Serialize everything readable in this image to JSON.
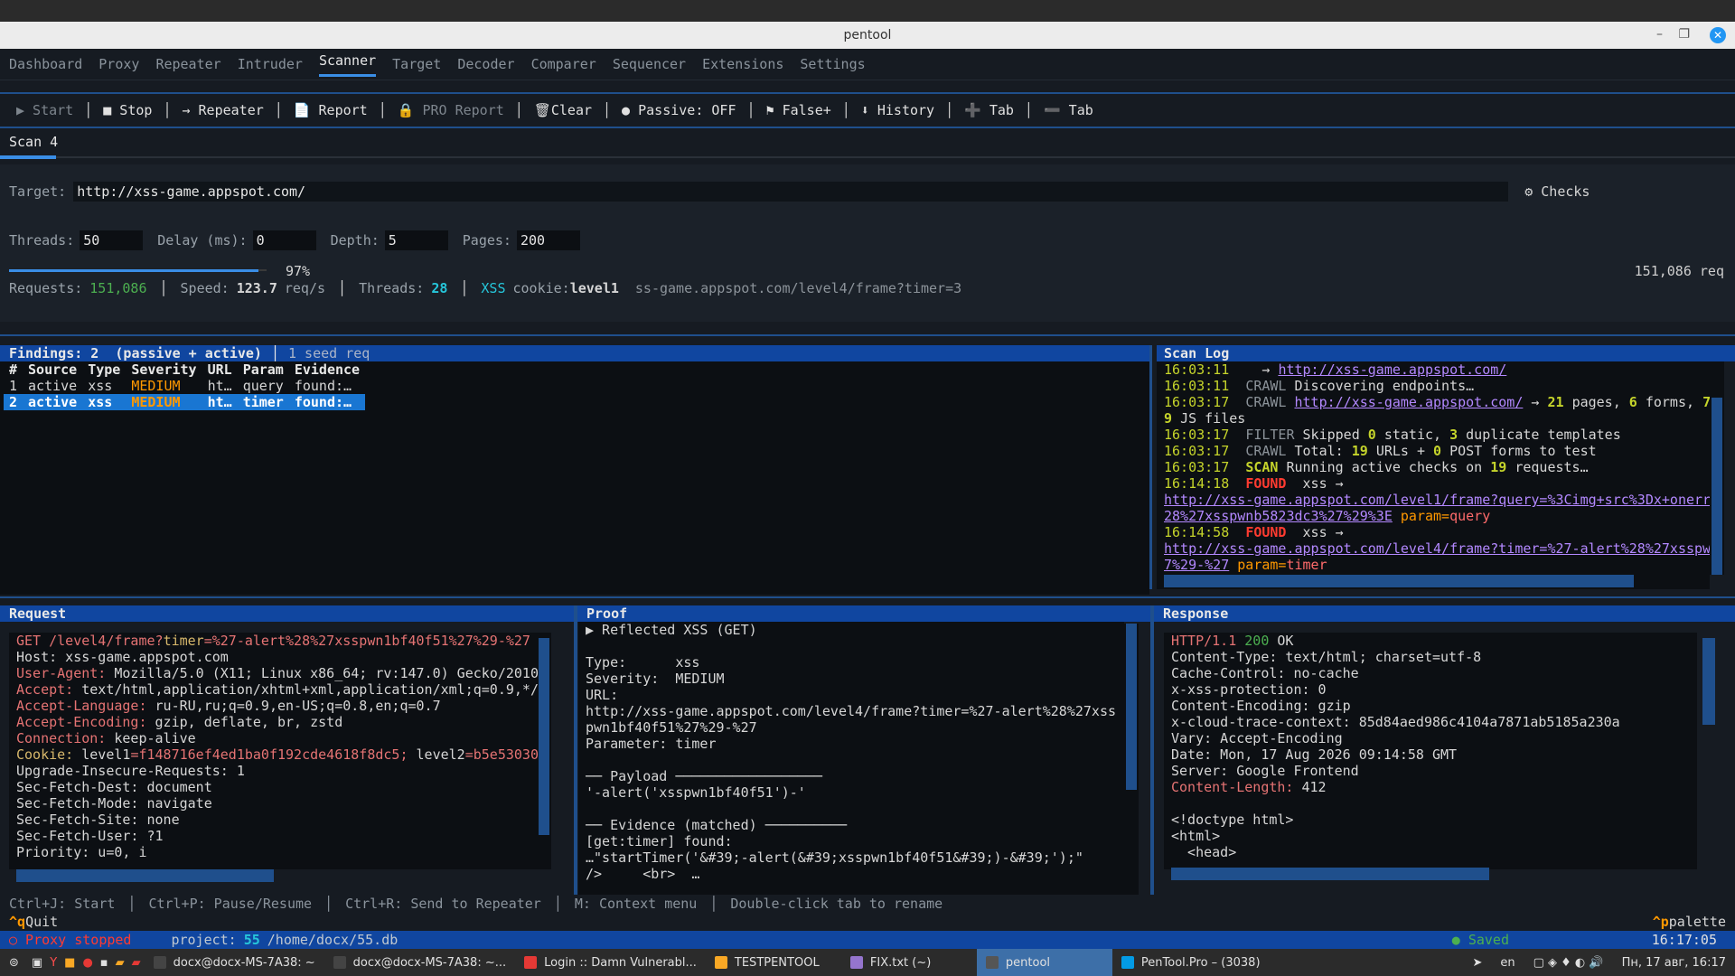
{
  "window": {
    "title": "pentool"
  },
  "tabs": [
    "Dashboard",
    "Proxy",
    "Repeater",
    "Intruder",
    "Scanner",
    "Target",
    "Decoder",
    "Comparer",
    "Sequencer",
    "Extensions",
    "Settings"
  ],
  "active_tab": "Scanner",
  "toolbar": {
    "start": "▶ Start",
    "stop": "■ Stop",
    "repeater": "→ Repeater",
    "report": "Report",
    "pro_report": "PRO Report",
    "clear": "Clear",
    "passive": "● Passive: OFF",
    "false_pos": "⚑ False+",
    "history": "⬇ History",
    "add_tab": "Tab",
    "remove_tab": "Tab"
  },
  "scan_tab": "Scan 4",
  "form": {
    "target_label": "Target:",
    "target_value": "http://xss-game.appspot.com/",
    "checks": "⚙ Checks",
    "threads_label": "Threads:",
    "threads_value": "50",
    "delay_label": "Delay (ms):",
    "delay_value": "0",
    "depth_label": "Depth:",
    "depth_value": "5",
    "pages_label": "Pages:",
    "pages_value": "200",
    "progress_text": "97%",
    "progress_value": 0.97,
    "req_total": "151,086 req",
    "requests_label": "Requests:",
    "requests_value": "151,086",
    "speed_label": "Speed:",
    "speed_value": "123.7",
    "speed_unit": "req/s",
    "threads2_label": "Threads:",
    "threads2_value": "28",
    "xss_label": "XSS",
    "cookie_label": "cookie:",
    "cookie_value": "level1",
    "current_url": "ss-game.appspot.com/level4/frame?timer=3"
  },
  "findings": {
    "title": "Findings: 2  (passive + active)",
    "seed": "1 seed req",
    "columns": [
      "#",
      "Source",
      "Type",
      "Severity",
      "URL",
      "Param",
      "Evidence"
    ],
    "rows": [
      [
        "1",
        "active",
        "xss",
        "MEDIUM",
        "ht…",
        "query",
        "found:…"
      ],
      [
        "2",
        "active",
        "xss",
        "MEDIUM",
        "ht…",
        "timer",
        "found:…"
      ]
    ]
  },
  "scan_log": {
    "title": "Scan Log",
    "l1_ts": "16:03:11",
    "l1_arrow": "→",
    "l1_url": "http://xss-game.appspot.com/",
    "l2_ts": "16:03:11",
    "l2_tag": "CRAWL",
    "l2_text": "Discovering endpoints…",
    "l3_ts": "16:03:17",
    "l3_tag": "CRAWL",
    "l3_url": "http://xss-game.appspot.com/",
    "l3_a": "→",
    "l3_n1": "21",
    "l3_b": "pages,",
    "l3_n2": "6",
    "l3_c": "forms,",
    "l3_n3": "7",
    "l4_n": "9",
    "l4_text": "JS files",
    "l5_ts": "16:03:17",
    "l5_tag": "FILTER",
    "l5_a": "Skipped",
    "l5_n1": "0",
    "l5_b": "static,",
    "l5_n2": "3",
    "l5_c": "duplicate templates",
    "l6_ts": "16:03:17",
    "l6_tag": "CRAWL",
    "l6_a": "Total:",
    "l6_n1": "19",
    "l6_b": "URLs +",
    "l6_n2": "0",
    "l6_c": "POST forms to test",
    "l7_ts": "16:03:17",
    "l7_tag": "SCAN",
    "l7_a": "Running active checks on",
    "l7_n": "19",
    "l7_b": "requests…",
    "l8_ts": "16:14:18",
    "l8_tag": "FOUND",
    "l8_text": "xss →",
    "l9_url": "http://xss-game.appspot.com/level1/frame?query=%3Cimg+src%3Dx+onerr",
    "l10_url": "28%27xsspwnb5823dc3%27%29%3E",
    "l10_param": "param=",
    "l10_pval": "query",
    "l11_ts": "16:14:58",
    "l11_tag": "FOUND",
    "l11_text": "xss →",
    "l12_url": "http://xss-game.appspot.com/level4/frame?timer=%27-alert%28%27xsspw",
    "l13_url": "7%29-%27",
    "l13_param": "param=",
    "l13_pval": "timer"
  },
  "request": {
    "title": "Request",
    "method": "GET",
    "path": "/level4/frame?",
    "qkey": "timer",
    "qval": "=%27-alert%28%27xsspwn1bf40f51%27%29-%27",
    "headers": [
      {
        "k": "Host:",
        "v": " xss-game.appspot.com",
        "style": "plain"
      },
      {
        "k": "User-Agent:",
        "v": " Mozilla/5.0 (X11; Linux x86_64; rv:147.0) Gecko/2010",
        "style": "red"
      },
      {
        "k": "Accept:",
        "v": " text/html,application/xhtml+xml,application/xml;q=0.9,*/",
        "style": "red"
      },
      {
        "k": "Accept-Language:",
        "v": " ru-RU,ru;q=0.9,en-US;q=0.8,en;q=0.7",
        "style": "red"
      },
      {
        "k": "Accept-Encoding:",
        "v": " gzip, deflate, br, zstd",
        "style": "red"
      },
      {
        "k": "Connection:",
        "v": " keep-alive",
        "style": "red"
      }
    ],
    "cookie_k": "Cookie:",
    "cookie_k1": "level1",
    "cookie_v1": "=f148716ef4ed1ba0f192cde4618f8dc5;",
    "cookie_k2": "level2",
    "cookie_v2": "=b5e53030",
    "headers2": [
      "Upgrade-Insecure-Requests: 1",
      "Sec-Fetch-Dest: document",
      "Sec-Fetch-Mode: navigate",
      "Sec-Fetch-Site: none",
      "Sec-Fetch-User: ?1",
      "Priority: u=0, i"
    ]
  },
  "proof": {
    "title": "Proof",
    "heading": "▶ Reflected XSS (GET)",
    "type_l": "Type:",
    "type_v": "xss",
    "sev_l": "Severity:",
    "sev_v": "MEDIUM",
    "url_l": "URL:",
    "url_1": "http://xss-game.appspot.com/level4/frame?timer=%27-alert%28%27xss",
    "url_2": "pwn1bf40f51%27%29-%27",
    "param_l": "Parameter:",
    "param_v": "timer",
    "payload_h": "── Payload ──────────────────",
    "payload": "'-alert('xsspwn1bf40f51')-'",
    "evidence_h": "── Evidence (matched) ──────────",
    "ev1": "[get:timer] found:",
    "ev2": "…\"startTimer('&#39;-alert(&#39;xsspwn1bf40f51&#39;)-&#39;');\"",
    "ev3": "/>     <br>  …"
  },
  "response": {
    "title": "Response",
    "status_a": "HTTP/1.1",
    "status_code": "200",
    "status_b": "OK",
    "lines": [
      "Content-Type: text/html; charset=utf-8",
      "Cache-Control: no-cache",
      "x-xss-protection: 0",
      "Content-Encoding: gzip",
      "x-cloud-trace-context: 85d84aed986c4104a7871ab5185a230a",
      "Vary: Accept-Encoding",
      "Date: Mon, 17 Aug 2026 09:14:58 GMT",
      "Server: Google Frontend"
    ],
    "cl_k": "Content-Length:",
    "cl_v": " 412",
    "body1": "<!doctype html>",
    "body2": "<html>",
    "body3": "  <head>"
  },
  "hints": {
    "h1": "Ctrl+J: Start",
    "h2": "Ctrl+P: Pause/Resume",
    "h3": "Ctrl+R: Send to Repeater",
    "h4": "M: Context menu",
    "h5": "Double-click tab to rename",
    "quit_key": "^q",
    "quit": "Quit",
    "palette_key": "^p",
    "palette": "palette"
  },
  "status": {
    "proxy": "○ Proxy stopped",
    "project_l": "project:",
    "project_n": "55",
    "project_path": "/home/docx/55.db",
    "saved": "● Saved",
    "time": "16:17:05"
  },
  "taskbar": {
    "items": [
      {
        "label": "docx@docx-MS-7A38: ~",
        "color": "#444"
      },
      {
        "label": "docx@docx-MS-7A38: ~...",
        "color": "#444"
      },
      {
        "label": "Login :: Damn Vulnerabl...",
        "color": "#e53935"
      },
      {
        "label": "TESTPENTOOL",
        "color": "#f9a825"
      },
      {
        "label": "FIX.txt (~)",
        "color": "#9575cd"
      },
      {
        "label": "pentool",
        "color": "#555"
      },
      {
        "label": "PenTool.Pro – (3038)",
        "color": "#039be5"
      }
    ],
    "lang": "en",
    "clock": "Пн, 17 авг, 16:17"
  }
}
